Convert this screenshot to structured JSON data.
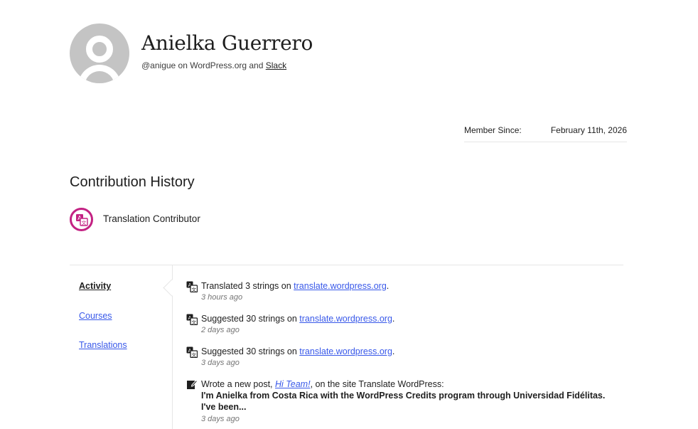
{
  "profile": {
    "name": "Anielka Guerrero",
    "handle_text": "@anigue on WordPress.org and ",
    "slack_label": "Slack",
    "member_since_label": "Member Since:",
    "member_since_value": "February 11th, 2026"
  },
  "contribution": {
    "title": "Contribution History",
    "badge_label": "Translation Contributor",
    "badge_color": "#c32283"
  },
  "nav": {
    "items": [
      {
        "label": "Activity",
        "active": true
      },
      {
        "label": "Courses",
        "active": false
      },
      {
        "label": "Translations",
        "active": false
      }
    ]
  },
  "activity": [
    {
      "icon": "translate-icon",
      "prefix": "Translated 3 strings on ",
      "link": "translate.wordpress.org",
      "suffix": ".",
      "time": "3 hours ago"
    },
    {
      "icon": "translate-icon",
      "prefix": "Suggested 30 strings on ",
      "link": "translate.wordpress.org",
      "suffix": ".",
      "time": "2 days ago"
    },
    {
      "icon": "translate-icon",
      "prefix": "Suggested 30 strings on ",
      "link": "translate.wordpress.org",
      "suffix": ".",
      "time": "3 days ago"
    },
    {
      "icon": "edit-post-icon",
      "prefix": "Wrote a new post, ",
      "link": "Hi Team!",
      "suffix": ", on the site Translate WordPress:",
      "excerpt": "I'm Anielka from Costa Rica with the WordPress Credits program through Universidad Fidélitas. I've been...",
      "time": "3 days ago"
    }
  ],
  "colors": {
    "link": "#3858e9",
    "text": "#1e1e1e",
    "muted": "#757575"
  }
}
